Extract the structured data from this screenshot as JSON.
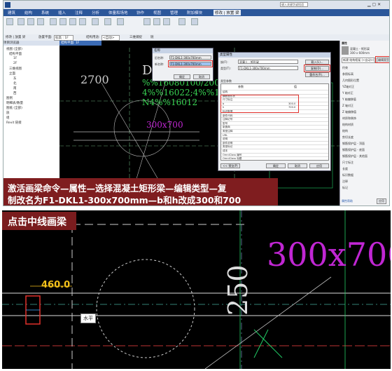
{
  "top_screenshot": {
    "menu_items": [
      "建筑",
      "结构",
      "系统",
      "插入",
      "注释",
      "分析",
      "体量和场地",
      "协作",
      "视图",
      "管理",
      "附加模块",
      "修改 | 放置 梁"
    ],
    "option_bar": [
      "修改 | 放置 梁",
      "放置平面:",
      "标高 : 1F",
      "结构用途:",
      "<自动>",
      "三维捕捉",
      "链"
    ],
    "search_placeholder": "键入关键字或短语",
    "project_browser": {
      "header": "项目浏览器",
      "items": [
        "视图 (全部)",
        "结构平面",
        "1F",
        "2F",
        "三维视图",
        "立面",
        "东",
        "北",
        "南",
        "西",
        "图例",
        "明细表/数量",
        "图纸 (全部)",
        "族",
        "组",
        "Revit 链接"
      ]
    },
    "view_tab": "结构平面: 1F",
    "cad": {
      "dim_2700": "2700",
      "beam_name": "DKL",
      "rebar_lines": [
        "%%16080100/200(2)",
        "4%%16022;4%%16022",
        "N4%%16012"
      ],
      "size_label": "300x700"
    },
    "rename_dialog": {
      "title": "名称",
      "old_label": "旧名称:",
      "old_value": "F1-DKL1-300x700mm",
      "new_label": "新名称:",
      "new_value": "F1-DKL1-300x700mm",
      "ok": "确定",
      "cancel": "取消"
    },
    "type_dialog": {
      "title": "类型属性",
      "family_label": "族(F):",
      "family_value": "混凝土 - 矩形梁",
      "type_label": "类型(T):",
      "type_value": "F1-DKL1-300x700mm",
      "load": "载入(L)...",
      "duplicate": "复制(D)...",
      "rename": "重命名(R)...",
      "params_header": "类型参数",
      "col_param": "参数",
      "col_value": "值",
      "rows": [
        {
          "name": "结构",
          "value": ""
        },
        {
          "name": "横断面形状",
          "value": ""
        },
        {
          "name": "尺寸标注",
          "value": ""
        },
        {
          "name": "b",
          "value": "300.0"
        },
        {
          "name": "h",
          "value": "700.0"
        },
        {
          "name": "标识数据",
          "value": ""
        },
        {
          "name": "部件代码",
          "value": ""
        },
        {
          "name": "注释记号",
          "value": ""
        },
        {
          "name": "型号",
          "value": ""
        },
        {
          "name": "制造商",
          "value": ""
        },
        {
          "name": "类型注释",
          "value": ""
        },
        {
          "name": "URL",
          "value": ""
        },
        {
          "name": "说明",
          "value": ""
        },
        {
          "name": "部件说明",
          "value": ""
        },
        {
          "name": "类型标记",
          "value": ""
        },
        {
          "name": "成本",
          "value": ""
        },
        {
          "name": "OmniClass 编号",
          "value": ""
        },
        {
          "name": "OmniClass 标题",
          "value": ""
        }
      ],
      "preview": "<< 预览(P)",
      "ok": "确定",
      "cancel": "取消",
      "apply": "应用"
    },
    "properties_panel": {
      "header": "属性",
      "family_name": "混凝土 - 矩形梁",
      "type_name": "300 x 600mm",
      "selector": "新建 结构框架 (<自动>)",
      "edit_type": "编辑类型",
      "sections": [
        "约束",
        "参照标高",
        "几何图形位置",
        "YZ轴对正",
        "Y 轴对正",
        "Y 轴偏移值",
        "Z 轴对正",
        "Z 轴偏移值",
        "材质和装饰",
        "结构材质",
        "结构",
        "剪切长度",
        "钢筋保护层 - 顶面",
        "钢筋保护层 - 底面",
        "钢筋保护层 - 其他面",
        "尺寸标注",
        "长度",
        "标识数据",
        "注释",
        "标记"
      ],
      "help": "属性帮助",
      "apply": "应用"
    },
    "caption_lines": [
      "激活画梁命令—属性—选择混凝土矩形梁—编辑类型—复",
      "制改名为F1-DKL1-300x700mm—b和h改成300和700"
    ]
  },
  "bottom_screenshot": {
    "label": "点击中线画梁",
    "dim_value": "460.0",
    "tooltip": "水平",
    "dim_250": "250",
    "size_label": "300x700"
  },
  "colors": {
    "caption_bg": "#7f1d1f",
    "cad_green": "#39d353",
    "cad_magenta": "#c026d3",
    "dim_yellow": "#f5c21a",
    "highlight_red": "#e0302b"
  }
}
